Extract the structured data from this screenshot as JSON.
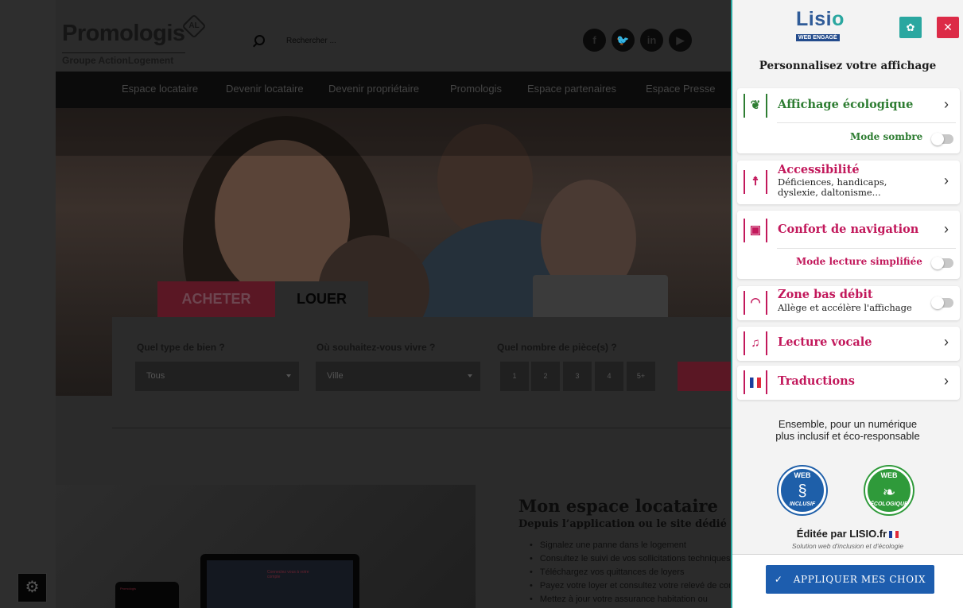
{
  "site": {
    "logo": {
      "name": "Promologis",
      "mark": "AL",
      "subtitle": "Groupe ActionLogement"
    },
    "search": {
      "placeholder": "Rechercher ..."
    },
    "social": [
      "f",
      "t",
      "in",
      "yt"
    ],
    "nav": [
      "Espace locataire",
      "Devenir locataire",
      "Devenir propriétaire",
      "Promologis",
      "Espace partenaires",
      "Espace Presse"
    ],
    "tabs": {
      "buy": "ACHETER",
      "rent": "LOUER"
    },
    "search_form": {
      "type_label": "Quel type de bien ?",
      "type_value": "Tous",
      "where_label": "Où souhaitez-vous vivre ?",
      "where_value": "Ville",
      "rooms_label": "Quel nombre de pièce(s) ?",
      "rooms": [
        "1",
        "2",
        "3",
        "4",
        "5+"
      ]
    },
    "tenant_section": {
      "title": "Mon espace locataire",
      "subtitle": "Depuis l’application ou le site dédié",
      "bullets": [
        "Signalez une panne dans le logement",
        "Consultez le suivi de vos sollicitations techniques",
        "Téléchargez vos quittances de loyers",
        "Payez votre loyer et consultez votre relevé de compte",
        "Mettez à jour votre assurance habitation ou"
      ],
      "laptop_text": "Connectez vous à votre compte"
    }
  },
  "panel": {
    "logo": {
      "word": "Lisio",
      "tag": "WEB ENGAGÉ"
    },
    "heading": "Personnalisez votre affichage",
    "cards": {
      "eco": {
        "title": "Affichage écologique",
        "toggle_label": "Mode sombre",
        "toggle_on": false
      },
      "access": {
        "title": "Accessibilité",
        "desc": "Déficiences, handicaps, dyslexie, daltonisme..."
      },
      "comfort": {
        "title": "Confort de navigation",
        "toggle_label": "Mode lecture simplifiée",
        "toggle_on": false
      },
      "lowbw": {
        "title": "Zone bas débit",
        "desc": "Allège et accélère l'affichage",
        "toggle_on": false
      },
      "voice": {
        "title": "Lecture vocale"
      },
      "translate": {
        "title": "Traductions"
      }
    },
    "tagline_1": "Ensemble, pour un numérique",
    "tagline_2": "plus inclusif et éco-responsable",
    "badges": {
      "inclusive": {
        "top": "WEB",
        "bottom": "INCLUSIF"
      },
      "eco": {
        "top": "WEB",
        "bottom": "ÉCOLOGIQUE"
      }
    },
    "edited_by": "Éditée par LISIO.fr",
    "solution": "Solution web d'inclusion et d'écologie",
    "apply": "APPLIQUER MES CHOIX",
    "colors": {
      "teal": "#2aa7a0",
      "red": "#dc2b47",
      "green": "#2e7d32",
      "blue": "#1d5dae",
      "magenta": "#c2185b"
    }
  }
}
